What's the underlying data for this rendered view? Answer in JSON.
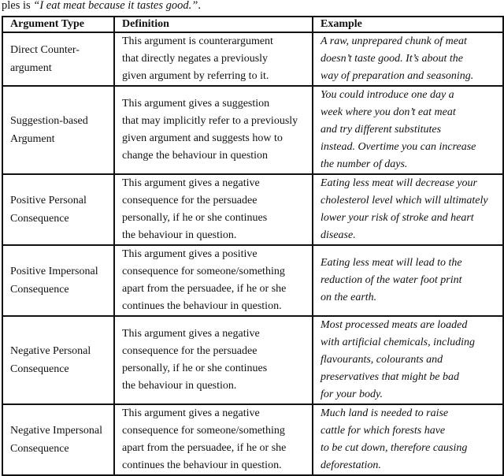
{
  "caption": {
    "prefix": "ples is ",
    "quote": "“I eat meat because it tastes good.”",
    "suffix": "."
  },
  "table": {
    "headers": [
      "Argument Type",
      "Definition",
      "Example"
    ],
    "rows": [
      {
        "type": [
          "Direct Counter-",
          "argument"
        ],
        "definition": [
          "This argument is counterargument",
          "that directly negates a previously",
          "given argument by referring to it."
        ],
        "example": [
          "A raw, unprepared chunk of meat",
          "doesn’t taste good. It’s about the",
          "way of preparation and seasoning."
        ]
      },
      {
        "type": [
          "Suggestion-based",
          "Argument"
        ],
        "definition": [
          "This argument gives a suggestion",
          "that may implicitly refer to a previously",
          "given argument and suggests how to",
          "change the behaviour in question"
        ],
        "example": [
          "You could introduce one day a",
          "week where you don’t eat meat",
          "and try different substitutes",
          "instead. Overtime you can increase",
          "the number of days."
        ]
      },
      {
        "type": [
          "Positive Personal",
          "Consequence"
        ],
        "definition": [
          "This argument gives a negative",
          "consequence for the persuadee",
          "personally, if he or she continues",
          "the behaviour in question."
        ],
        "example": [
          "Eating less meat will decrease your",
          "cholesterol level which will ultimately",
          "lower your risk of stroke and heart",
          "disease."
        ]
      },
      {
        "type": [
          "Positive Impersonal",
          "Consequence"
        ],
        "definition": [
          "This argument gives a positive",
          "consequence for someone/something",
          "apart from the persuadee, if he or she",
          "continues the behaviour in question."
        ],
        "example": [
          "Eating less meat will lead to the",
          "reduction of the water foot print",
          "on the earth."
        ]
      },
      {
        "type": [
          "Negative Personal",
          "Consequence"
        ],
        "definition": [
          "This argument gives a negative",
          "consequence for the persuadee",
          "personally, if he or she continues",
          "the behaviour in question."
        ],
        "example": [
          "Most processed meats are loaded",
          "with artificial chemicals, including",
          "flavourants, colourants and",
          "preservatives that might be bad",
          "for your body."
        ]
      },
      {
        "type": [
          "Negative Impersonal",
          "Consequence"
        ],
        "definition": [
          "This argument gives a negative",
          "consequence for someone/something",
          "apart from the persuadee, if he or she",
          "continues the behaviour in question."
        ],
        "example": [
          "Much land is needed to raise",
          "cattle for which forests have",
          "to be cut down, therefore causing",
          "deforestation."
        ]
      }
    ]
  }
}
